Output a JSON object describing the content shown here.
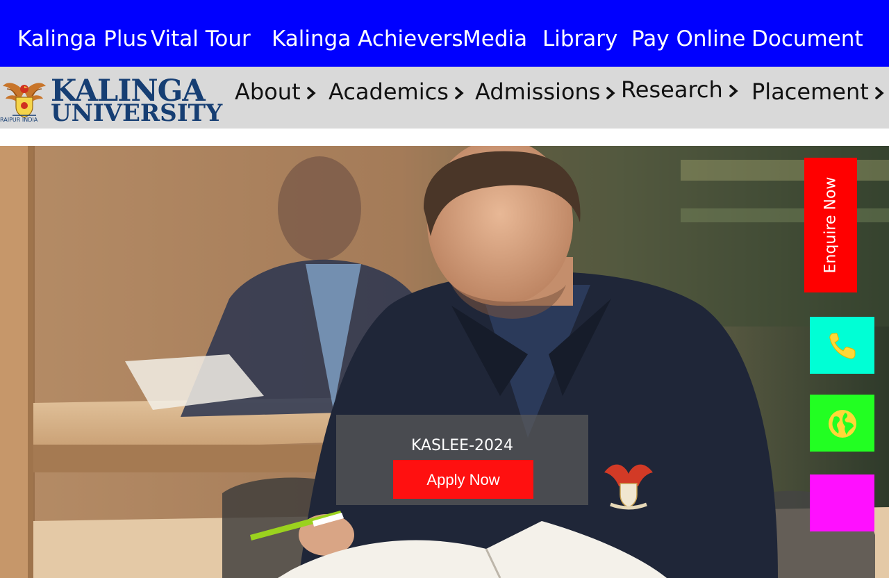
{
  "topbar": {
    "links": [
      "Kalinga Plus",
      "Vital Tour",
      "Kalinga Achievers",
      "Media",
      "Library",
      "Pay Online",
      "Document"
    ],
    "color": "#0000ff"
  },
  "logo": {
    "line1": "KALINGA",
    "line2": "UNIVERSITY",
    "tagline": "RAIPUR INDIA"
  },
  "mainnav": {
    "items": [
      "About",
      "Academics",
      "Admissions",
      "Research",
      "Placement"
    ]
  },
  "hero": {
    "cta_title": "KASLEE-2024",
    "cta_button": "Apply Now"
  },
  "side": {
    "enquire": "Enquire Now",
    "buttons": [
      {
        "icon": "phone-icon",
        "color": "#00ffd5"
      },
      {
        "icon": "globe-icon",
        "color": "#22ff22"
      },
      {
        "icon": "blank",
        "color": "#ff10ff"
      }
    ]
  }
}
